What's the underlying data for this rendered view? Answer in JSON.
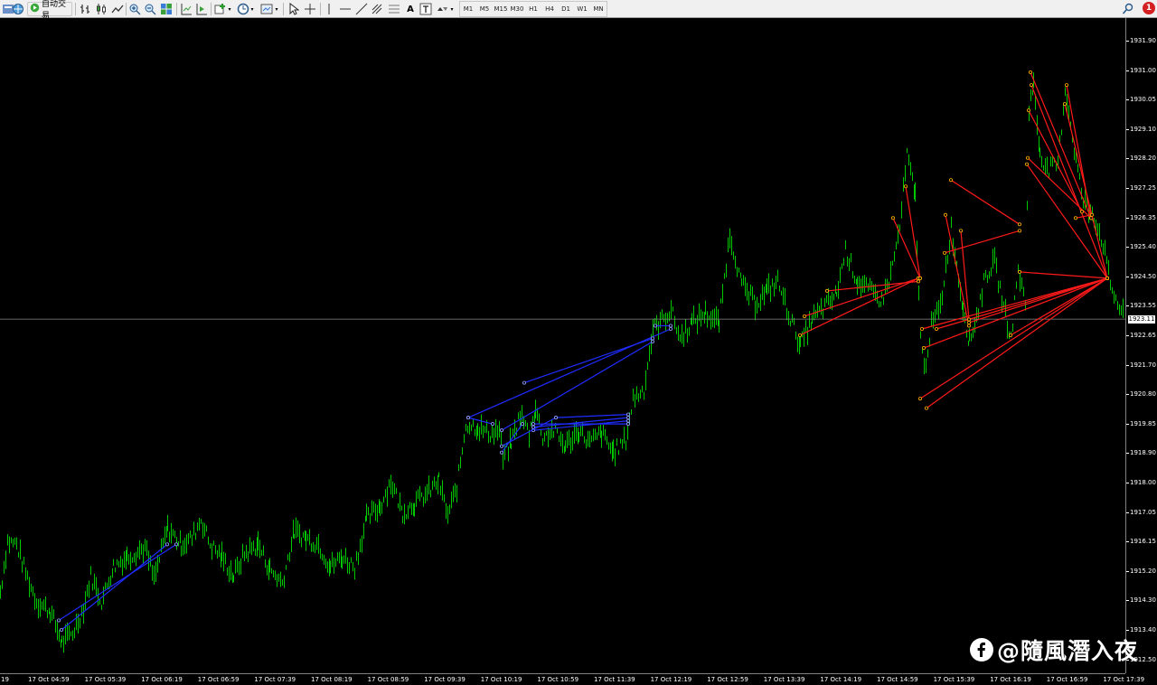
{
  "toolbar": {
    "autotrade_label": "自动交易",
    "timeframes": [
      "M1",
      "M5",
      "M15",
      "M30",
      "H1",
      "H4",
      "D1",
      "W1",
      "MN"
    ],
    "alert_count": "1",
    "icons": [
      "new-order-icon",
      "market-watch-icon",
      "autotrade-icon",
      "bar-chart-icon",
      "candlestick-icon",
      "line-chart-icon",
      "zoom-in-icon",
      "zoom-out-icon",
      "tile-windows-icon",
      "chart-shift-icon",
      "indicators-icon",
      "period-icon",
      "templates-icon",
      "cursor-icon",
      "crosshair-icon",
      "vertical-line-icon",
      "horizontal-line-icon",
      "trendline-icon",
      "fibonacci-icon",
      "text-icon",
      "text-label-icon",
      "arrows-icon",
      "search-icon",
      "alert-icon"
    ]
  },
  "chart": {
    "symbol_price_axis": [
      "1931.90",
      "1931.00",
      "1930.05",
      "1929.10",
      "1928.20",
      "1927.25",
      "1926.35",
      "1925.40",
      "1924.50",
      "1923.55",
      "1922.65",
      "1921.70",
      "1920.80",
      "1919.85",
      "1918.90",
      "1918.00",
      "1917.05",
      "1916.15",
      "1915.20",
      "1914.30",
      "1913.40",
      "1912.50"
    ],
    "current_price": "1923.11",
    "time_axis": [
      "17 Oct 04:59",
      "17 Oct 05:39",
      "17 Oct 06:19",
      "17 Oct 06:59",
      "17 Oct 07:39",
      "17 Oct 08:19",
      "17 Oct 08:59",
      "17 Oct 09:39",
      "17 Oct 10:19",
      "17 Oct 10:59",
      "17 Oct 11:39",
      "17 Oct 12:19",
      "17 Oct 12:59",
      "17 Oct 13:39",
      "17 Oct 14:19",
      "17 Oct 14:59",
      "17 Oct 15:39",
      "17 Oct 16:19",
      "17 Oct 16:59",
      "17 Oct 17:39"
    ],
    "time_axis_left_fragment": "19",
    "colors": {
      "background": "#000000",
      "bars": "#00c800",
      "blue_lines": "#1f2cff",
      "red_lines": "#ff1a1a",
      "bid_line": "#8a8a8a"
    },
    "price_path": [
      [
        0,
        1914.5
      ],
      [
        8,
        1916.1
      ],
      [
        18,
        1916.0
      ],
      [
        28,
        1915.1
      ],
      [
        40,
        1914.2
      ],
      [
        55,
        1913.9
      ],
      [
        68,
        1912.9
      ],
      [
        80,
        1913.2
      ],
      [
        92,
        1914.0
      ],
      [
        100,
        1915.0
      ],
      [
        112,
        1914.2
      ],
      [
        125,
        1915.3
      ],
      [
        140,
        1915.6
      ],
      [
        160,
        1915.9
      ],
      [
        170,
        1914.9
      ],
      [
        185,
        1916.5
      ],
      [
        200,
        1916.0
      ],
      [
        212,
        1916.2
      ],
      [
        222,
        1916.8
      ],
      [
        232,
        1916.0
      ],
      [
        245,
        1915.6
      ],
      [
        258,
        1915.0
      ],
      [
        270,
        1915.7
      ],
      [
        285,
        1916.0
      ],
      [
        298,
        1915.2
      ],
      [
        312,
        1914.8
      ],
      [
        325,
        1916.4
      ],
      [
        338,
        1916.2
      ],
      [
        352,
        1916.0
      ],
      [
        365,
        1915.3
      ],
      [
        378,
        1915.6
      ],
      [
        392,
        1915.3
      ],
      [
        405,
        1916.8
      ],
      [
        420,
        1917.2
      ],
      [
        432,
        1918.0
      ],
      [
        445,
        1917.0
      ],
      [
        458,
        1917.3
      ],
      [
        472,
        1917.6
      ],
      [
        485,
        1918.0
      ],
      [
        495,
        1916.9
      ],
      [
        505,
        1917.8
      ],
      [
        515,
        1919.8
      ],
      [
        528,
        1919.7
      ],
      [
        540,
        1919.5
      ],
      [
        552,
        1919.6
      ],
      [
        556,
        1918.7
      ],
      [
        565,
        1919.2
      ],
      [
        575,
        1920.1
      ],
      [
        585,
        1919.5
      ],
      [
        592,
        1920.3
      ],
      [
        600,
        1919.4
      ],
      [
        612,
        1919.6
      ],
      [
        625,
        1919.1
      ],
      [
        640,
        1919.6
      ],
      [
        652,
        1919.2
      ],
      [
        665,
        1919.5
      ],
      [
        678,
        1918.9
      ],
      [
        692,
        1919.3
      ],
      [
        700,
        1920.6
      ],
      [
        712,
        1920.9
      ],
      [
        722,
        1922.8
      ],
      [
        730,
        1923.0
      ],
      [
        742,
        1923.4
      ],
      [
        752,
        1922.5
      ],
      [
        765,
        1923.0
      ],
      [
        780,
        1923.3
      ],
      [
        795,
        1923.0
      ],
      [
        807,
        1925.8
      ],
      [
        820,
        1924.2
      ],
      [
        835,
        1923.6
      ],
      [
        848,
        1924.0
      ],
      [
        860,
        1924.3
      ],
      [
        872,
        1923.3
      ],
      [
        885,
        1922.3
      ],
      [
        898,
        1923.1
      ],
      [
        912,
        1923.5
      ],
      [
        925,
        1923.9
      ],
      [
        935,
        1925.3
      ],
      [
        948,
        1924.3
      ],
      [
        962,
        1924.0
      ],
      [
        975,
        1923.7
      ],
      [
        985,
        1924.5
      ],
      [
        995,
        1926.0
      ],
      [
        1003,
        1928.3
      ],
      [
        1012,
        1927.0
      ],
      [
        1018,
        1922.5
      ],
      [
        1022,
        1921.5
      ],
      [
        1030,
        1922.9
      ],
      [
        1040,
        1923.5
      ],
      [
        1052,
        1926.0
      ],
      [
        1058,
        1924.8
      ],
      [
        1065,
        1923.5
      ],
      [
        1072,
        1922.4
      ],
      [
        1080,
        1923.2
      ],
      [
        1090,
        1924.5
      ],
      [
        1100,
        1924.9
      ],
      [
        1110,
        1923.5
      ],
      [
        1118,
        1922.5
      ],
      [
        1126,
        1924.7
      ],
      [
        1134,
        1923.6
      ],
      [
        1138,
        1929.8
      ],
      [
        1143,
        1930.5
      ],
      [
        1150,
        1928.4
      ],
      [
        1158,
        1927.8
      ],
      [
        1170,
        1928.0
      ],
      [
        1178,
        1930.4
      ],
      [
        1188,
        1928.5
      ],
      [
        1198,
        1926.8
      ],
      [
        1208,
        1926.5
      ],
      [
        1220,
        1925.5
      ],
      [
        1228,
        1924.2
      ],
      [
        1236,
        1923.6
      ],
      [
        1244,
        1923.11
      ]
    ],
    "blue_lines": [
      [
        [
          65,
          1913.6
        ],
        [
          195,
          1916.0
        ]
      ],
      [
        [
          68,
          1913.3
        ],
        [
          185,
          1916.0
        ]
      ],
      [
        [
          518,
          1920.0
        ],
        [
          742,
          1922.8
        ]
      ],
      [
        [
          580,
          1921.1
        ],
        [
          722,
          1922.5
        ]
      ],
      [
        [
          555,
          1919.6
        ],
        [
          722,
          1922.4
        ]
      ],
      [
        [
          590,
          1919.6
        ],
        [
          695,
          1919.9
        ]
      ],
      [
        [
          590,
          1919.7
        ],
        [
          695,
          1920.0
        ]
      ],
      [
        [
          590,
          1919.8
        ],
        [
          695,
          1919.8
        ]
      ],
      [
        [
          615,
          1920.0
        ],
        [
          695,
          1920.1
        ]
      ],
      [
        [
          555,
          1918.9
        ],
        [
          578,
          1919.8
        ]
      ],
      [
        [
          518,
          1920.0
        ],
        [
          545,
          1919.8
        ]
      ],
      [
        [
          725,
          1922.9
        ],
        [
          742,
          1922.9
        ]
      ],
      [
        [
          555,
          1919.1
        ],
        [
          615,
          1920.0
        ]
      ]
    ],
    "red_lines": [
      [
        [
          885,
          1922.6
        ],
        [
          1016,
          1924.4
        ]
      ],
      [
        [
          890,
          1923.2
        ],
        [
          1016,
          1924.4
        ]
      ],
      [
        [
          915,
          1924.0
        ],
        [
          1016,
          1924.3
        ]
      ],
      [
        [
          988,
          1926.3
        ],
        [
          1018,
          1924.4
        ]
      ],
      [
        [
          1002,
          1927.3
        ],
        [
          1018,
          1924.4
        ]
      ],
      [
        [
          1020,
          1922.8
        ],
        [
          1225,
          1924.4
        ]
      ],
      [
        [
          1022,
          1922.2
        ],
        [
          1225,
          1924.4
        ]
      ],
      [
        [
          1018,
          1920.6
        ],
        [
          1225,
          1924.4
        ]
      ],
      [
        [
          1025,
          1920.3
        ],
        [
          1225,
          1924.4
        ]
      ],
      [
        [
          1036,
          1922.8
        ],
        [
          1225,
          1924.4
        ]
      ],
      [
        [
          1045,
          1925.2
        ],
        [
          1128,
          1925.9
        ]
      ],
      [
        [
          1052,
          1927.5
        ],
        [
          1128,
          1926.1
        ]
      ],
      [
        [
          1046,
          1926.4
        ],
        [
          1072,
          1922.9
        ]
      ],
      [
        [
          1063,
          1925.9
        ],
        [
          1072,
          1923.1
        ]
      ],
      [
        [
          1072,
          1923.0
        ],
        [
          1225,
          1924.4
        ]
      ],
      [
        [
          1118,
          1922.6
        ],
        [
          1225,
          1924.4
        ]
      ],
      [
        [
          1128,
          1924.6
        ],
        [
          1225,
          1924.4
        ]
      ],
      [
        [
          1140,
          1930.9
        ],
        [
          1207,
          1926.3
        ]
      ],
      [
        [
          1141,
          1930.5
        ],
        [
          1225,
          1924.4
        ]
      ],
      [
        [
          1137,
          1928.2
        ],
        [
          1207,
          1926.3
        ]
      ],
      [
        [
          1138,
          1929.7
        ],
        [
          1197,
          1926.5
        ]
      ],
      [
        [
          1180,
          1930.5
        ],
        [
          1207,
          1926.3
        ]
      ],
      [
        [
          1178,
          1929.9
        ],
        [
          1225,
          1924.4
        ]
      ],
      [
        [
          1136,
          1928.0
        ],
        [
          1225,
          1924.4
        ]
      ],
      [
        [
          1190,
          1926.3
        ],
        [
          1208,
          1926.4
        ]
      ]
    ]
  },
  "watermark": {
    "text": "@隨風潛入夜",
    "icon": "facebook-icon"
  }
}
